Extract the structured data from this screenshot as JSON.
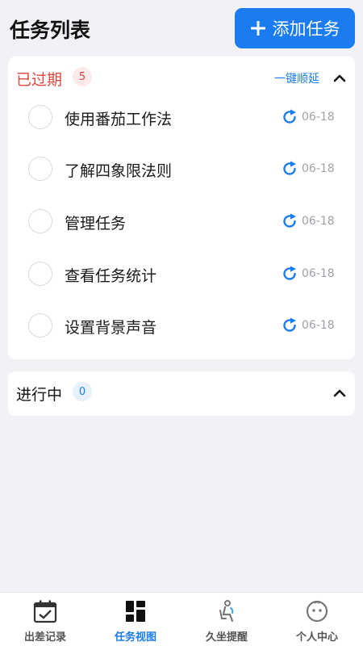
{
  "header": {
    "title": "任务列表",
    "add_button_label": "添加任务"
  },
  "sections": {
    "overdue": {
      "title": "已过期",
      "count": "5",
      "postpone_label": "一键顺延",
      "tasks": [
        {
          "label": "使用番茄工作法",
          "date": "06-18"
        },
        {
          "label": "了解四象限法则",
          "date": "06-18"
        },
        {
          "label": "管理任务",
          "date": "06-18"
        },
        {
          "label": "查看任务统计",
          "date": "06-18"
        },
        {
          "label": "设置背景声音",
          "date": "06-18"
        }
      ]
    },
    "in_progress": {
      "title": "进行中",
      "count": "0"
    }
  },
  "tabbar": {
    "items": [
      {
        "label": "出差记录",
        "icon": "calendar-check-icon"
      },
      {
        "label": "任务视图",
        "icon": "grid-view-icon",
        "active": true
      },
      {
        "label": "久坐提醒",
        "icon": "sitting-person-icon"
      },
      {
        "label": "个人中心",
        "icon": "face-icon"
      }
    ]
  },
  "colors": {
    "accent": "#1a7cf0",
    "overdue": "#e0463c",
    "background": "#f2f2f6",
    "date_gray": "#a0a0a8"
  }
}
